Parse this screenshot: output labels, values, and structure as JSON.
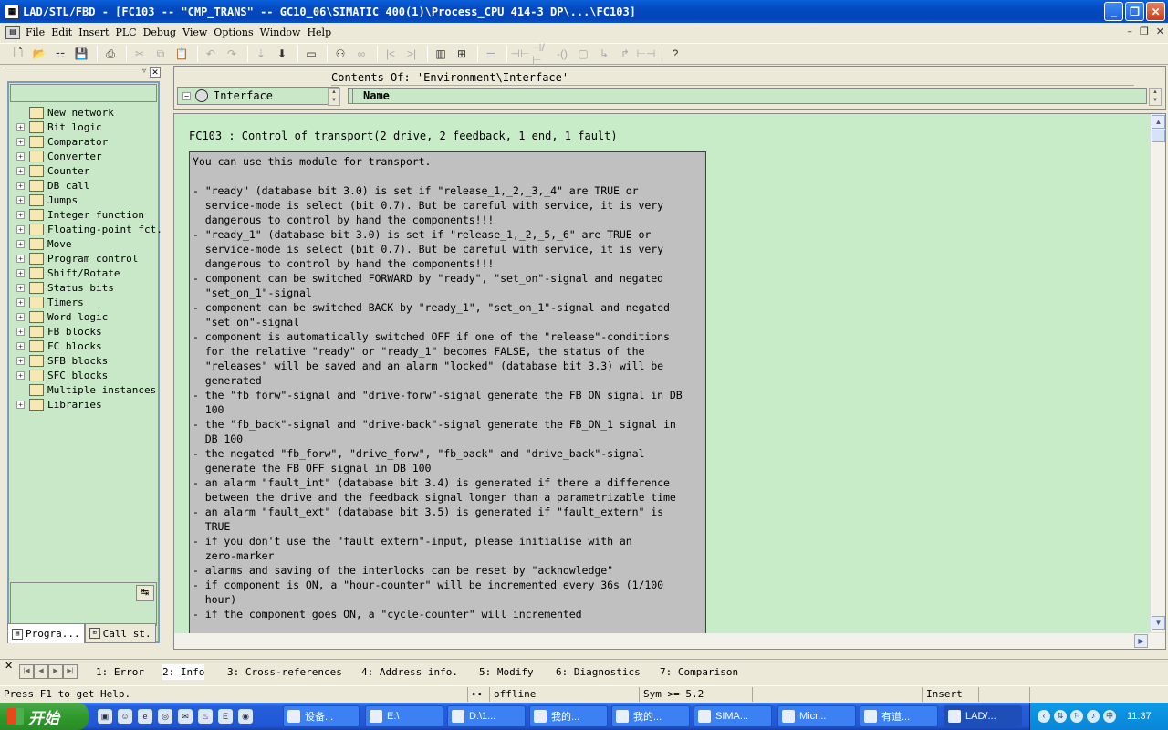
{
  "window": {
    "title": "LAD/STL/FBD  - [FC103 -- \"CMP_TRANS\" -- GC10_06\\SIMATIC 400(1)\\Process_CPU 414-3 DP\\...\\FC103]",
    "app_icon": "LAD"
  },
  "menu": [
    "File",
    "Edit",
    "Insert",
    "PLC",
    "Debug",
    "View",
    "Options",
    "Window",
    "Help"
  ],
  "tree": [
    {
      "label": "New network",
      "icon": "new-network-icon",
      "expandable": false
    },
    {
      "label": "Bit logic",
      "icon": "bit-logic-icon",
      "expandable": true
    },
    {
      "label": "Comparator",
      "icon": "comparator-icon",
      "expandable": true
    },
    {
      "label": "Converter",
      "icon": "converter-icon",
      "expandable": true
    },
    {
      "label": "Counter",
      "icon": "counter-icon",
      "expandable": true
    },
    {
      "label": "DB call",
      "icon": "db-call-icon",
      "expandable": true
    },
    {
      "label": "Jumps",
      "icon": "jumps-icon",
      "expandable": true
    },
    {
      "label": "Integer function",
      "icon": "integer-function-icon",
      "expandable": true
    },
    {
      "label": "Floating-point fct.",
      "icon": "floating-point-icon",
      "expandable": true
    },
    {
      "label": "Move",
      "icon": "move-icon",
      "expandable": true
    },
    {
      "label": "Program control",
      "icon": "program-control-icon",
      "expandable": true
    },
    {
      "label": "Shift/Rotate",
      "icon": "shift-rotate-icon",
      "expandable": true
    },
    {
      "label": "Status bits",
      "icon": "status-bits-icon",
      "expandable": true
    },
    {
      "label": "Timers",
      "icon": "timers-icon",
      "expandable": true
    },
    {
      "label": "Word logic",
      "icon": "word-logic-icon",
      "expandable": true
    },
    {
      "label": "FB blocks",
      "icon": "fb-blocks-icon",
      "expandable": true
    },
    {
      "label": "FC blocks",
      "icon": "fc-blocks-icon",
      "expandable": true
    },
    {
      "label": "SFB blocks",
      "icon": "sfb-blocks-icon",
      "expandable": true
    },
    {
      "label": "SFC blocks",
      "icon": "sfc-blocks-icon",
      "expandable": true
    },
    {
      "label": "Multiple instances",
      "icon": "multiple-instances-icon",
      "expandable": false
    },
    {
      "label": "Libraries",
      "icon": "libraries-icon",
      "expandable": true
    }
  ],
  "left_tabs": [
    "Progra...",
    "Call st."
  ],
  "interface": {
    "contents_label": "Contents Of: 'Environment\\Interface'",
    "tree_label": "Interface",
    "column_name": "Name"
  },
  "editor": {
    "block_title": "FC103 : Control of transport(2 drive, 2 feedback, 1 end, 1 fault)",
    "comment_lines": [
      "You can use this module for transport.",
      "",
      "- \"ready\" (database bit 3.0) is set if \"release_1,_2,_3,_4\" are TRUE or",
      "  service-mode is select (bit 0.7). But be careful with service, it is very",
      "  dangerous to control by hand the components!!!",
      "- \"ready_1\" (database bit 3.0) is set if \"release_1,_2,_5,_6\" are TRUE or",
      "  service-mode is select (bit 0.7). But be careful with service, it is very",
      "  dangerous to control by hand the components!!!",
      "- component can be switched FORWARD by \"ready\", \"set_on\"-signal and negated",
      "  \"set_on_1\"-signal",
      "- component can be switched BACK by \"ready_1\", \"set_on_1\"-signal and negated",
      "  \"set_on\"-signal",
      "- component is automatically switched OFF if one of the \"release\"-conditions",
      "  for the relative \"ready\" or \"ready_1\" becomes FALSE, the status of the",
      "  \"releases\" will be saved and an alarm \"locked\" (database bit 3.3) will be",
      "  generated",
      "- the \"fb_forw\"-signal and \"drive-forw\"-signal generate the FB_ON signal in DB",
      "  100",
      "- the \"fb_back\"-signal and \"drive-back\"-signal generate the FB_ON_1 signal in",
      "  DB 100",
      "- the negated \"fb_forw\", \"drive_forw\", \"fb_back\" and \"drive_back\"-signal",
      "  generate the FB_OFF signal in DB 100",
      "- an alarm \"fault_int\" (database bit 3.4) is generated if there a difference",
      "  between the drive and the feedback signal longer than a parametrizable time",
      "- an alarm \"fault_ext\" (database bit 3.5) is generated if \"fault_extern\" is",
      "  TRUE",
      "- if you don't use the \"fault_extern\"-input, please initialise with an",
      "  zero-marker",
      "- alarms and saving of the interlocks can be reset by \"acknowledge\"",
      "- if component is ON, a \"hour-counter\" will be incremented every 36s (1/100",
      "  hour)",
      "- if the component goes ON, a \"cycle-counter\" will incremented"
    ]
  },
  "bottom_tabs": [
    "1: Error",
    "2: Info",
    "3: Cross-references",
    "4: Address info.",
    "5: Modify",
    "6: Diagnostics",
    "7: Comparison"
  ],
  "status": {
    "help": "Press F1 to get Help.",
    "mode": "offline",
    "sym": "Sym >= 5.2",
    "insert": "Insert"
  },
  "taskbar": {
    "start": "开始",
    "tasks": [
      "设备...",
      "E:\\",
      "D:\\1...",
      "我的...",
      "我的...",
      "SIMA...",
      "Micr...",
      "有道...",
      "LAD/..."
    ],
    "clock": "11:37"
  }
}
